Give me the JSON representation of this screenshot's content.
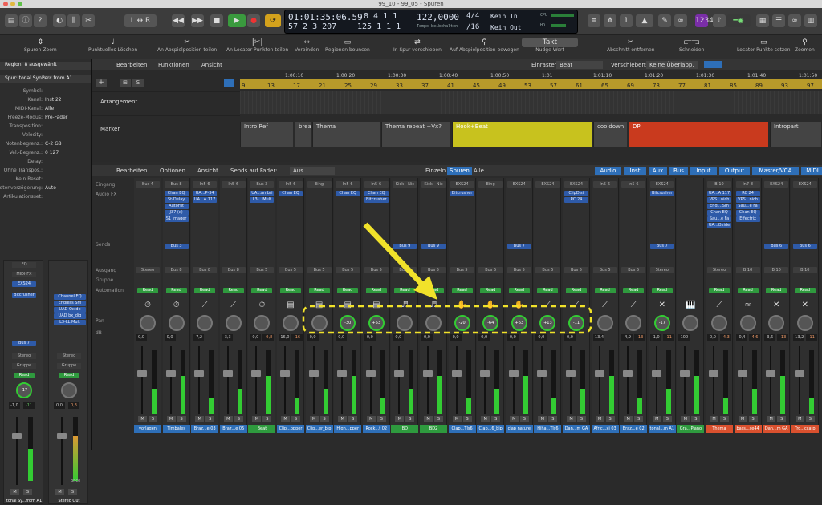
{
  "window": {
    "title": "99_10 - 99_05 - Spuren"
  },
  "lcd": {
    "time": "01:01:35:06.59",
    "pos1": "8  4  1    1",
    "pos2": "57  2  3  207",
    "pos3": "125  1  1    1",
    "tempo": "122,0000",
    "tempo_sub": "Tempo beibehalten",
    "sig": "4/4",
    "sig_sub": "/16",
    "in": "Kein In",
    "out": "Kein Out",
    "cpu": "CPU",
    "hd": "HD",
    "counter": "1234"
  },
  "toolbar": {
    "icons": [
      "library-icon",
      "info-icon",
      "help-icon",
      "smart-controls-icon",
      "mixer-icon",
      "editors-icon"
    ],
    "transport": [
      "rewind-icon",
      "forward-icon",
      "stop-icon",
      "play-icon",
      "record-icon",
      "cycle-icon"
    ]
  },
  "commands": [
    "Spuren-Zoom",
    "Punktuelles Löschen",
    "An Abspielposition teilen",
    "An Locator-Punkten teilen",
    "Verbinden",
    "Regionen bouncen",
    "In Spur verschieben",
    "Auf Abspielposition bewegen",
    "Nudge-Wert",
    "Abschnitt entfernen",
    "Schneiden",
    "Locator-Punkte setzen",
    "Zoomen"
  ],
  "nudge": "Takt",
  "inspector": {
    "region": "Region: 8 ausgewählt",
    "track": "Spur:  tonal SynPerc from A1",
    "rows": [
      [
        "Symbol:",
        ""
      ],
      [
        "Kanal:",
        "Inst 22"
      ],
      [
        "MIDI-Kanal:",
        "Alle"
      ],
      [
        "Freeze-Modus:",
        "Pre-Fader"
      ],
      [
        "Transposition:",
        ""
      ],
      [
        "Velocity:",
        ""
      ],
      [
        "Notenbegrenz.:",
        "C-2  G8"
      ],
      [
        "Vel.-Begrenz.:",
        "0  127"
      ],
      [
        "Delay:",
        ""
      ],
      [
        "Ohne Transpos.:",
        ""
      ],
      [
        "Kein Reset:",
        ""
      ],
      [
        "Notenverzögerung:",
        "Auto"
      ],
      [
        "Artikulationsset:",
        ""
      ]
    ],
    "strip1": {
      "eq": "EQ",
      "midifx": "MIDI-FX",
      "inst": "EXS24",
      "plugins": [
        "Bitcrusher"
      ],
      "bus": "Bus 7",
      "mode": "Stereo",
      "group": "Gruppe",
      "auto": "Read",
      "pan": "-17",
      "db": "-1,0",
      "peak": "-11",
      "name": "tonal Sy...from A1"
    },
    "strip2": {
      "plugins": [
        "Channel EQ",
        "Endless Sm",
        "UAD Oxide",
        "UAD bx_dig",
        "L3-LL Mult"
      ],
      "mode": "Stereo",
      "group": "Gruppe",
      "auto": "Read",
      "db": "0,0",
      "peak": "0,3",
      "extra": "Bnce",
      "name": "Stereo Out"
    }
  },
  "arrange": {
    "menus": [
      "Bearbeiten",
      "Funktionen",
      "Ansicht"
    ],
    "snap_label": "Einrasten:",
    "snap": "Beat",
    "move_label": "Verschieben:",
    "move": "Keine Überlapp.",
    "ruler": [
      "9",
      "13",
      "17",
      "21",
      "25",
      "29",
      "33",
      "37",
      "41",
      "45",
      "49",
      "53",
      "57",
      "61",
      "65",
      "69",
      "73",
      "77",
      "81",
      "85",
      "89",
      "93",
      "97",
      "101",
      "105",
      "109",
      "113",
      "117",
      "121",
      "125"
    ],
    "times": [
      "1:00:10",
      "1:00:20",
      "1:00:30",
      "1:00:40",
      "1:00:50",
      "1:01",
      "1:01:10",
      "1:01:20",
      "1:01:30",
      "1:01:40",
      "1:01:50",
      "1:02"
    ],
    "tracks": [
      "Arrangement",
      "Marker"
    ],
    "markers": [
      "Intro Ref",
      "break",
      "Thema",
      "Thema repeat +Vx?",
      "Hook+Beat",
      "cooldown",
      "DP",
      "Intropart"
    ]
  },
  "mixer": {
    "menus": [
      "Bearbeiten",
      "Optionen",
      "Ansicht",
      "Sends auf Fader:",
      "Aus"
    ],
    "tabs": [
      "Einzeln",
      "Spuren",
      "Alle"
    ],
    "filters": [
      "Audio",
      "Inst",
      "Aux",
      "Bus",
      "Input",
      "Output",
      "Master/VCA",
      "MIDI"
    ],
    "labels": [
      "Eingang",
      "Audio FX",
      "Sends",
      "Ausgang",
      "Gruppe",
      "Automation",
      "Pan",
      "dB"
    ],
    "channels": [
      {
        "in": "Bus 4",
        "fx": [],
        "send": "",
        "out": "Stereo",
        "pan": "",
        "db": "0,0",
        "pk": "",
        "name": "vorlagen",
        "color": "#2e6fb8",
        "ico": "⏱"
      },
      {
        "in": "Bus 8",
        "fx": [
          "Chan EQ",
          "St-Delay",
          "AutoFilt",
          "J37 (x)",
          "S1 Imager"
        ],
        "send": "Bus 3",
        "out": "Bus 8",
        "pan": "",
        "db": "0,0",
        "pk": "",
        "name": "Timbales",
        "color": "#2e6fb8",
        "ico": "⏱"
      },
      {
        "in": "In5-6",
        "fx": [
          "UA...P-34",
          "UA...A 117"
        ],
        "send": "",
        "out": "Bus 8",
        "pan": "",
        "db": "-7,2",
        "pk": "",
        "name": "Braz...e 03",
        "color": "#2e6fb8",
        "ico": "⟋"
      },
      {
        "in": "In5-6",
        "fx": [],
        "send": "",
        "out": "Bus 8",
        "pan": "",
        "db": "-3,3",
        "pk": "",
        "name": "Braz...e 05",
        "color": "#2e6fb8",
        "ico": "⟋"
      },
      {
        "in": "Bus 3",
        "fx": [
          "UA...ambri",
          "L3-...Mult"
        ],
        "send": "",
        "out": "Bus 5",
        "pan": "",
        "db": "0,0",
        "pk": "-0,8",
        "name": "Beat",
        "color": "#2e9a3e",
        "ico": "⏱"
      },
      {
        "in": "In5-6",
        "fx": [
          "Chan EQ"
        ],
        "send": "",
        "out": "Bus 5",
        "pan": "",
        "db": "-16,0",
        "pk": "-16",
        "name": "Clip...opper",
        "color": "#2e6fb8",
        "ico": "▤"
      },
      {
        "in": "Eing",
        "fx": [],
        "send": "",
        "out": "Bus 5",
        "pan": "",
        "db": "0,0",
        "pk": "",
        "name": "Clip...er_bip",
        "color": "#2e6fb8",
        "ico": "▤"
      },
      {
        "in": "In5-6",
        "fx": [
          "Chan EQ"
        ],
        "send": "",
        "out": "Bus 5",
        "pan": "-30",
        "db": "0,0",
        "pk": "",
        "name": "High...pper",
        "color": "#2e6fb8",
        "ico": "▤"
      },
      {
        "in": "In5-6",
        "fx": [
          "Chan EQ",
          "Bitcrusher"
        ],
        "send": "",
        "out": "Bus 5",
        "pan": "+53",
        "db": "0,0",
        "pk": "",
        "name": "Rock...t 02",
        "color": "#2e6fb8",
        "ico": "▤"
      },
      {
        "in": "Kick - Nic",
        "fx": [],
        "send": "Bus 9",
        "out": "Bus 5",
        "pan": "",
        "db": "0,0",
        "pk": "",
        "name": "BD",
        "color": "#2e9a3e",
        "ico": "♬"
      },
      {
        "in": "Kick - Nic",
        "fx": [],
        "send": "Bus 9",
        "out": "Bus 5",
        "pan": "",
        "db": "0,0",
        "pk": "",
        "name": "BD2",
        "color": "#2e9a3e",
        "ico": "♬"
      },
      {
        "in": "EXS24",
        "fx": [
          "Bitcrusher"
        ],
        "send": "",
        "out": "Bus 5",
        "pan": "-20",
        "db": "0,0",
        "pk": "",
        "name": "Clap...Tls6",
        "color": "#2e6fb8",
        "ico": "✋"
      },
      {
        "in": "Eing",
        "fx": [],
        "send": "",
        "out": "Bus 5",
        "pan": "-64",
        "db": "0,0",
        "pk": "",
        "name": "Clap...6_bip",
        "color": "#2e6fb8",
        "ico": "✋"
      },
      {
        "in": "EXS24",
        "fx": [],
        "send": "Bus 7",
        "out": "Bus 5",
        "pan": "+63",
        "db": "0,0",
        "pk": "",
        "name": "clap nature",
        "color": "#2e6fb8",
        "ico": "✋"
      },
      {
        "in": "EXS24",
        "fx": [],
        "send": "",
        "out": "Bus 5",
        "pan": "+13",
        "db": "0,0",
        "pk": "",
        "name": "Hiha...Tls6",
        "color": "#2e6fb8",
        "ico": "⟋"
      },
      {
        "in": "EXS24",
        "fx": [
          "ClipDist",
          "RC 24"
        ],
        "send": "",
        "out": "Bus 5",
        "pan": "-11",
        "db": "0,0",
        "pk": "",
        "name": "Dan...m GA",
        "color": "#2e6fb8",
        "ico": "⟋"
      },
      {
        "in": "In5-6",
        "fx": [],
        "send": "",
        "out": "Bus 5",
        "pan": "",
        "db": "-13,4",
        "pk": "",
        "name": "Afric...xi 03",
        "color": "#2e6fb8",
        "ico": "⟋"
      },
      {
        "in": "In5-6",
        "fx": [],
        "send": "",
        "out": "Bus 5",
        "pan": "",
        "db": "-4,9",
        "pk": "-13",
        "name": "Braz...e 02",
        "color": "#2e6fb8",
        "ico": "⟋"
      },
      {
        "in": "EXS24",
        "fx": [
          "Bitcrusher"
        ],
        "send": "Bus 7",
        "out": "Stereo",
        "pan": "-17",
        "db": "-1,0",
        "pk": "-11",
        "name": "tonal...m A1",
        "color": "#2e6fb8",
        "ico": "✕"
      },
      {
        "in": "",
        "fx": [],
        "send": "",
        "out": "",
        "pan": "",
        "db": "100",
        "pk": "",
        "name": "Gra...Piano",
        "color": "#2e9a3e",
        "ico": "🎹"
      },
      {
        "in": "B 10",
        "fx": [
          "UA...A 117",
          "VPS...nich",
          "Endl...Sm",
          "Chan EQ",
          "Sau...e Fa",
          "UA...Oxide"
        ],
        "send": "",
        "out": "Stereo",
        "pan": "",
        "db": "0,0",
        "pk": "-4,3",
        "name": "Thema",
        "color": "#d9502e",
        "ico": "⟋"
      },
      {
        "in": "In7-8",
        "fx": [
          "RC 24",
          "VPS...nich",
          "Sau...e Fa",
          "Chan EQ",
          "Effectrix"
        ],
        "send": "",
        "out": "B 10",
        "pan": "",
        "db": "-0,4",
        "pk": "-4,6",
        "name": "bass...se44",
        "color": "#d9502e",
        "ico": "≈"
      },
      {
        "in": "EXS24",
        "fx": [],
        "send": "Bus 6",
        "out": "B 10",
        "pan": "",
        "db": "3,6",
        "pk": "-13",
        "name": "Dan...m GA",
        "color": "#d9502e",
        "ico": "✕"
      },
      {
        "in": "EXS24",
        "fx": [],
        "send": "Bus 6",
        "out": "B 10",
        "pan": "",
        "db": "-13,2",
        "pk": "-11",
        "name": "Tro...ccato",
        "color": "#d9502e",
        "ico": "✕"
      }
    ]
  },
  "annotation": {
    "arrow": "yellow-arrow",
    "highlight": "pan-highlight-box"
  }
}
